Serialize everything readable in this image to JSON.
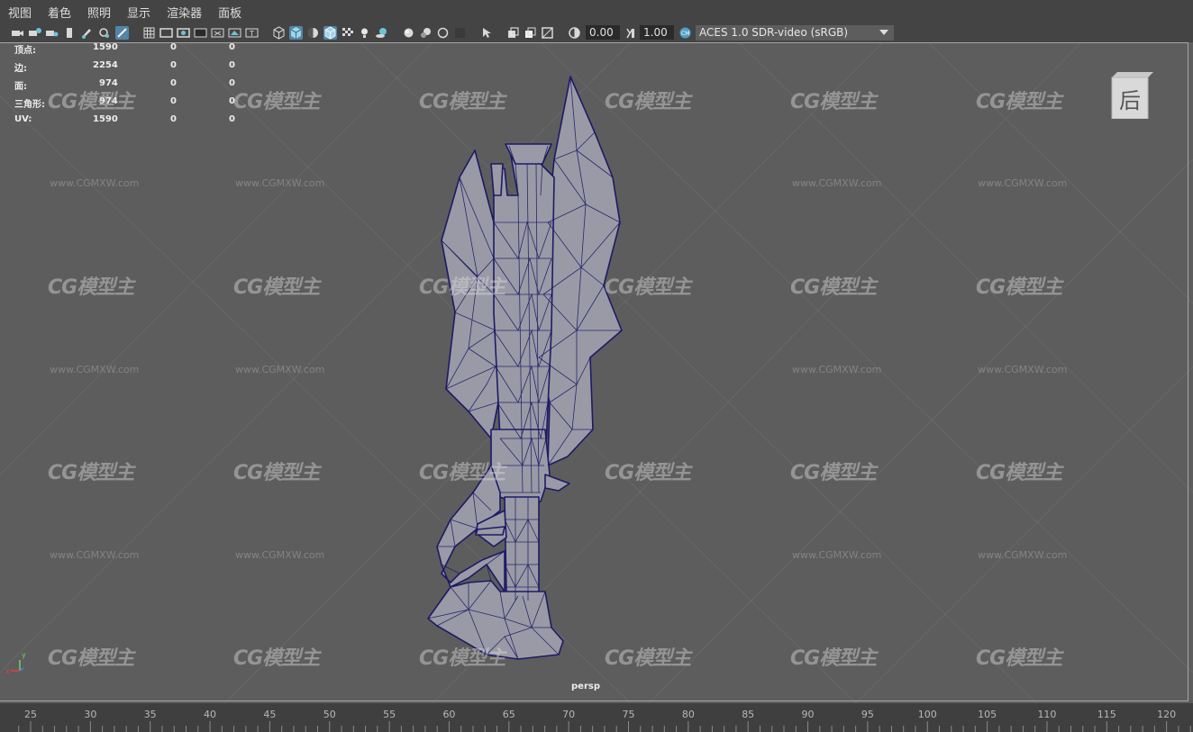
{
  "menu": [
    "视图",
    "着色",
    "照明",
    "显示",
    "渲染器",
    "面板"
  ],
  "toolbar": {
    "exposure": "0.00",
    "gamma": "1.00",
    "color_space": "ACES 1.0 SDR-video (sRGB)"
  },
  "hud": {
    "rows": [
      {
        "label": "顶点:",
        "values": [
          "1590",
          "0",
          "0"
        ]
      },
      {
        "label": "边:",
        "values": [
          "2254",
          "0",
          "0"
        ]
      },
      {
        "label": "面:",
        "values": [
          "974",
          "0",
          "0"
        ]
      },
      {
        "label": "三角形:",
        "values": [
          "974",
          "0",
          "0"
        ]
      },
      {
        "label": "UV:",
        "values": [
          "1590",
          "0",
          "0"
        ]
      }
    ]
  },
  "viewcube": {
    "face_label": "后"
  },
  "camera_label": "persp",
  "axis": {
    "y": "y",
    "x": "x"
  },
  "watermark": {
    "logo": "CG模型主",
    "url": "www.CGMXW.com"
  },
  "timeline": {
    "labels": [
      "25",
      "30",
      "35",
      "40",
      "45",
      "50",
      "55",
      "60",
      "65",
      "70",
      "75",
      "80",
      "85",
      "90",
      "95",
      "100",
      "105",
      "110",
      "115",
      "120"
    ]
  },
  "colors": {
    "viewport_bg": "#5d5d5d",
    "mesh_fill": "#9a9aa6",
    "wire": "#1d1a66",
    "highlight": "#5285a6"
  }
}
